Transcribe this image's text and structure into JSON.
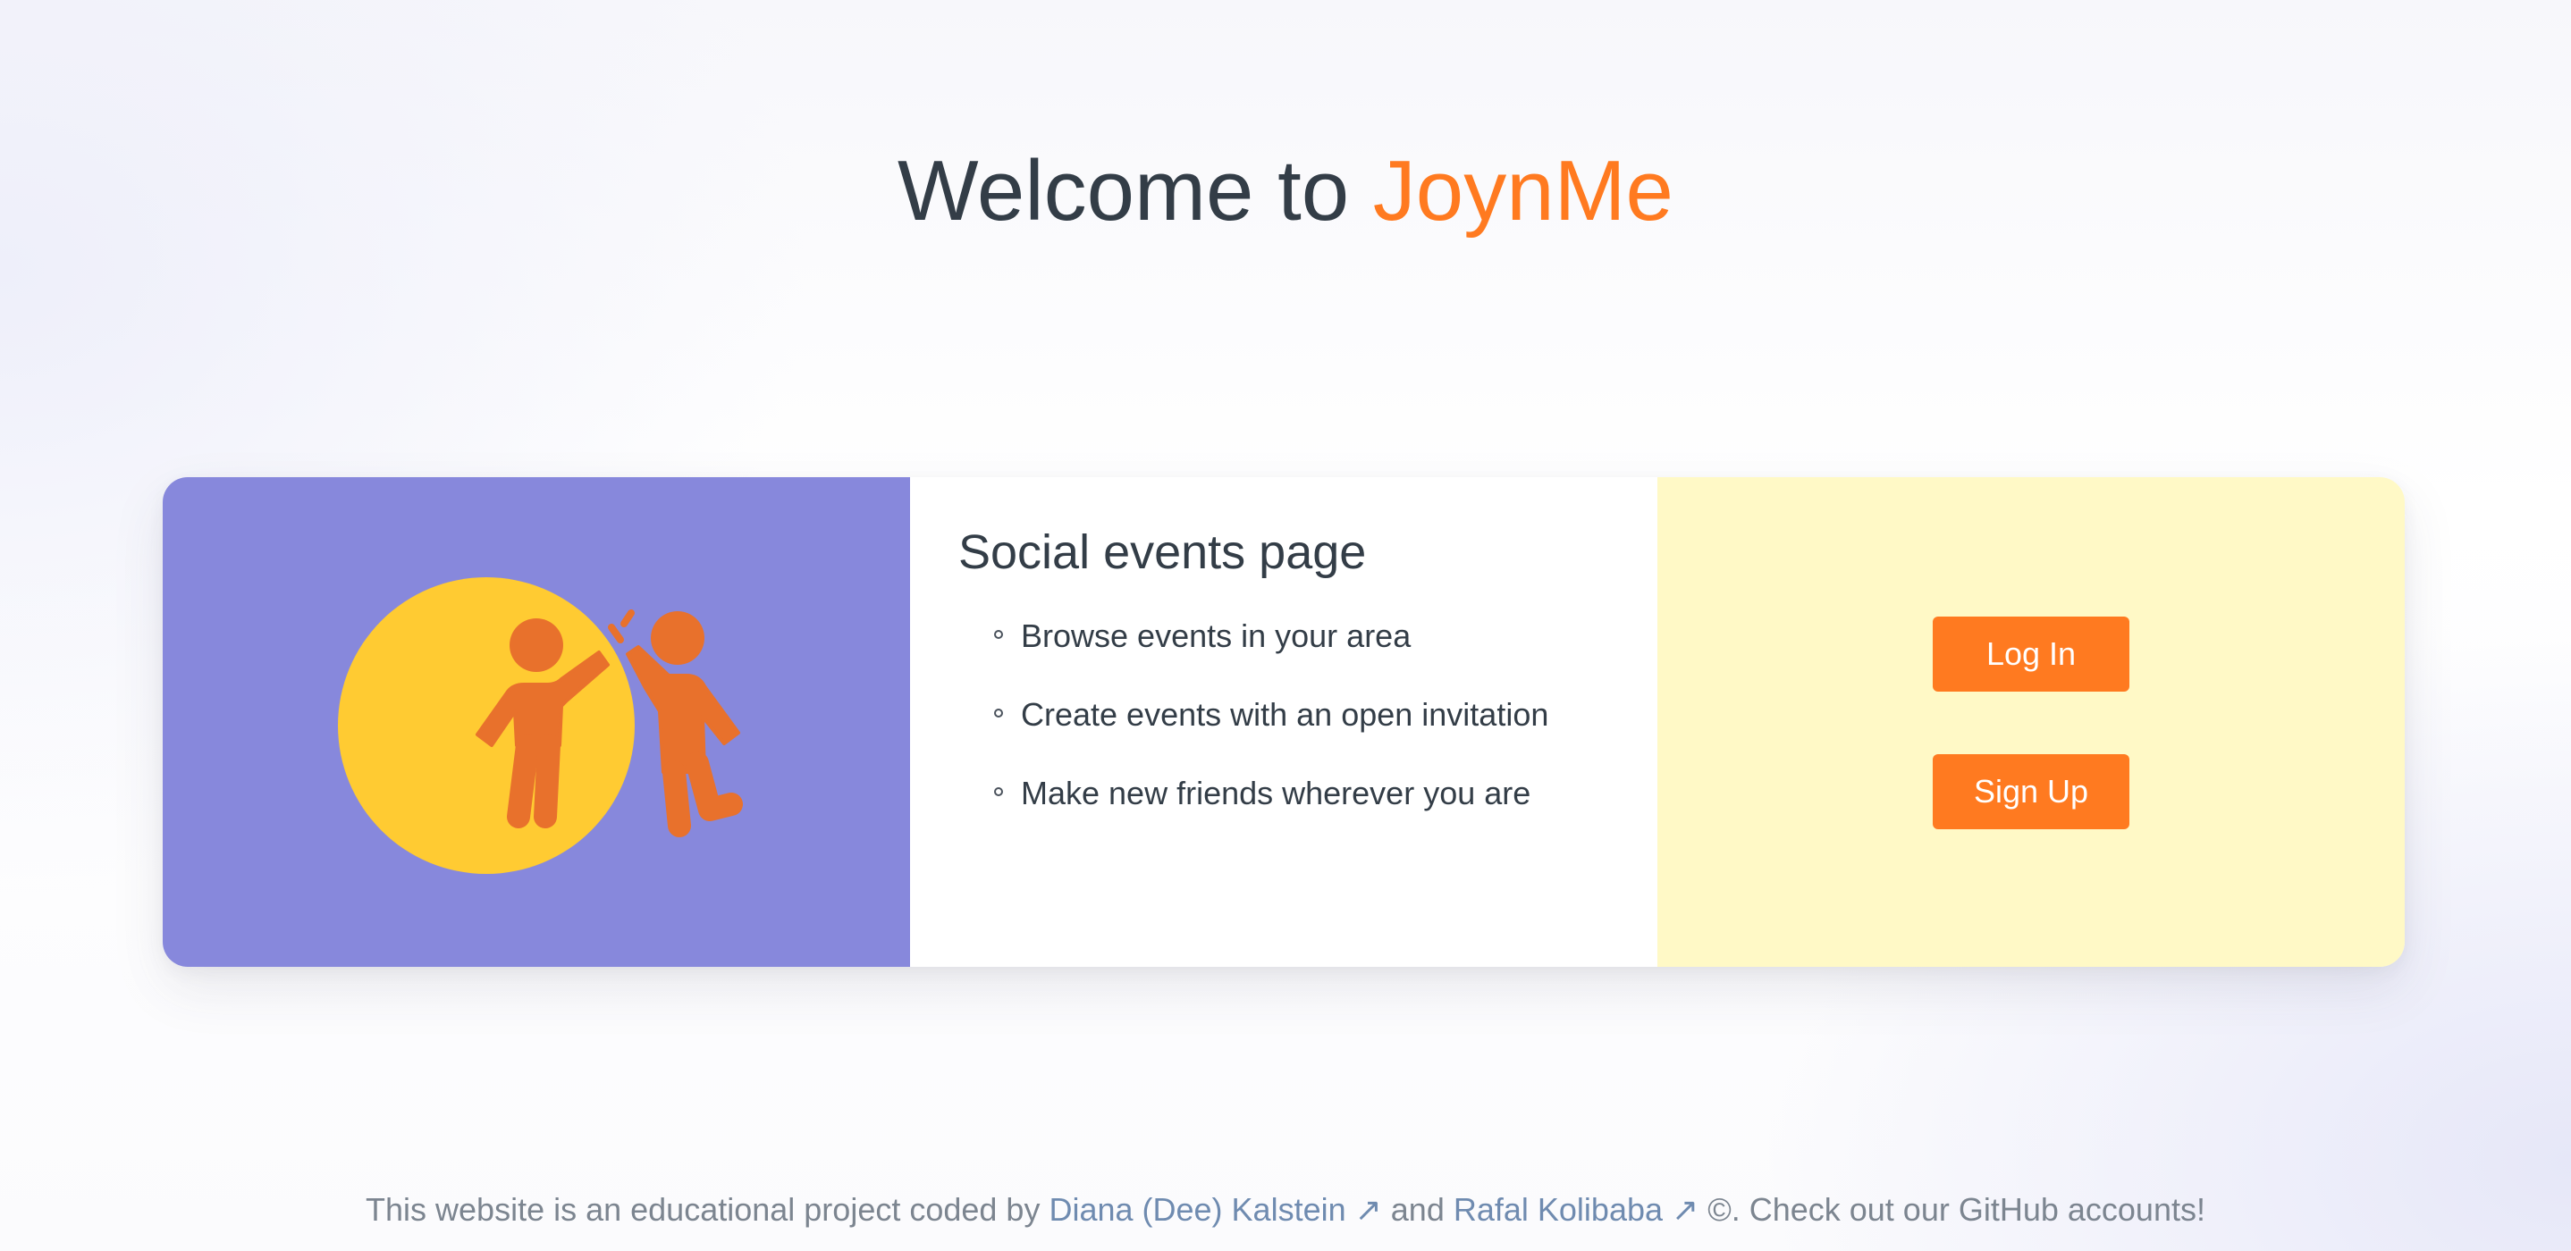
{
  "header": {
    "title_prefix": "Welcome to ",
    "brand": "JoynMe"
  },
  "card": {
    "illustration": {
      "icon": "high-five-people-icon",
      "colors": {
        "panel": "#8788dc",
        "circle": "#ffcb32",
        "figures": "#e8712c"
      }
    },
    "info": {
      "title": "Social events page",
      "features": [
        "Browse events in your area",
        "Create events with an open invitation",
        "Make new friends wherever you are"
      ]
    },
    "actions": {
      "login_label": "Log In",
      "signup_label": "Sign Up"
    }
  },
  "footer": {
    "text_before": "This website is an educational project coded by ",
    "author1": "Diana (Dee) Kalstein ↗",
    "text_between": " and ",
    "author2": "Rafal Kolibaba ↗",
    "text_after": " ©. Check out our GitHub accounts!"
  },
  "colors": {
    "accent": "#ff7a20",
    "text": "#333d47",
    "link": "#6f8bb0",
    "actions_panel": "#fff9c6"
  }
}
